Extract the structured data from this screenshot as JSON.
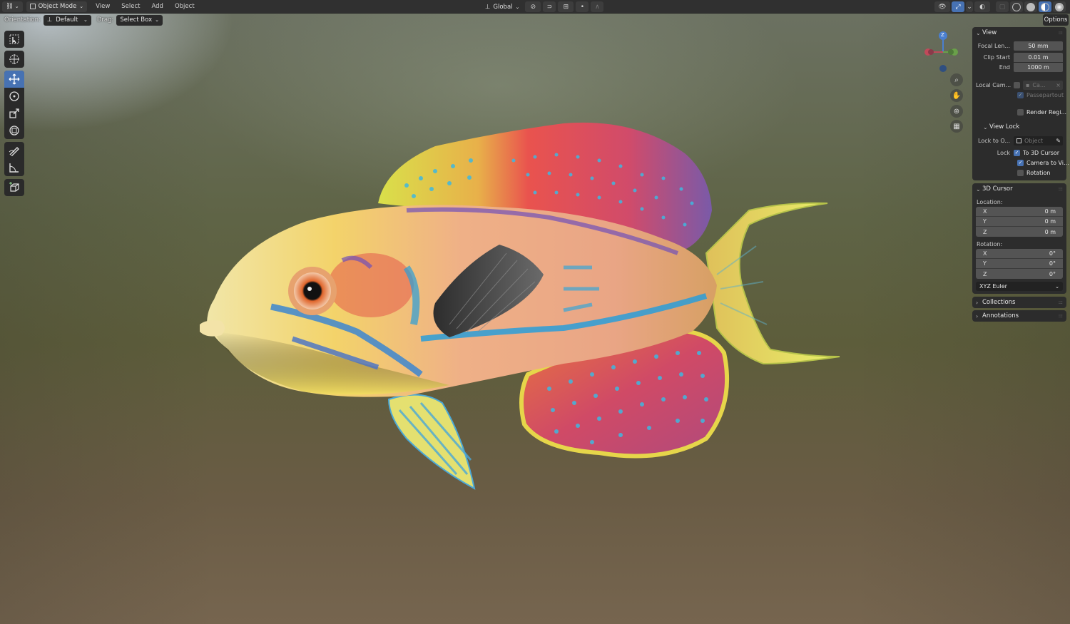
{
  "header": {
    "editor_icon": "3d-viewport-icon",
    "mode": "Object Mode",
    "menus": [
      "View",
      "Select",
      "Add",
      "Object"
    ],
    "transform_orientation": "Global"
  },
  "tool_settings": {
    "orientation_label": "Orientation:",
    "orientation_value": "Default",
    "drag_label": "Drag:",
    "drag_value": "Select Box",
    "options_label": "Options"
  },
  "toolbar": {
    "tools": [
      "select-box-icon",
      "cursor-icon",
      "move-icon",
      "rotate-icon",
      "scale-icon",
      "transform-icon",
      "annotate-icon",
      "measure-icon",
      "add-cube-icon"
    ],
    "active_tool": "move-icon"
  },
  "gizmo": {
    "z_label": "Z"
  },
  "sidebar": {
    "view": {
      "title": "View",
      "focal_length_label": "Focal Len...",
      "focal_length_value": "50 mm",
      "clip_start_label": "Clip Start",
      "clip_start_value": "0.01 m",
      "clip_end_label": "End",
      "clip_end_value": "1000 m",
      "local_camera_label": "Local Cam...",
      "local_camera_value": "Ca...",
      "passepartout_label": "Passepartout",
      "render_region_label": "Render Regi..."
    },
    "view_lock": {
      "title": "View Lock",
      "lock_to_object_label": "Lock to O...",
      "lock_to_object_placeholder": "Object",
      "lock_label": "Lock",
      "to_3d_cursor_label": "To 3D Cursor",
      "camera_to_view_label": "Camera to Vi...",
      "rotation_label": "Rotation"
    },
    "cursor": {
      "title": "3D Cursor",
      "location_label": "Location:",
      "location": [
        {
          "axis": "X",
          "value": "0 m"
        },
        {
          "axis": "Y",
          "value": "0 m"
        },
        {
          "axis": "Z",
          "value": "0 m"
        }
      ],
      "rotation_label": "Rotation:",
      "rotation": [
        {
          "axis": "X",
          "value": "0°"
        },
        {
          "axis": "Y",
          "value": "0°"
        },
        {
          "axis": "Z",
          "value": "0°"
        }
      ],
      "rotation_mode": "XYZ Euler"
    },
    "collections": {
      "title": "Collections"
    },
    "annotations": {
      "title": "Annotations"
    }
  },
  "colors": {
    "accent": "#4772b3",
    "header_bg": "#303030",
    "panel_bg": "#2c2c2c",
    "field_bg": "#545454"
  }
}
